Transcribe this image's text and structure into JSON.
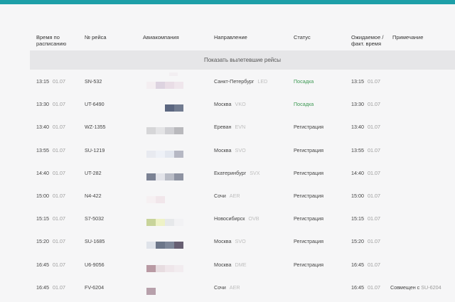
{
  "headers": {
    "scheduled": "Время по расписанию",
    "flight": "№ рейса",
    "airline": "Авиакомпания",
    "direction": "Направление",
    "status": "Статус",
    "expected": "Ожидаемое / факт. время",
    "note": "Примечание"
  },
  "show_departed": "Показать вылетевшие рейсы",
  "colors": {
    "accent": "#1d9fa8",
    "boarding": "#3f9a55"
  },
  "flights": [
    {
      "time": "13:15",
      "date": "01.07",
      "flight": "SN-532",
      "city": "Санкт-Петербург",
      "code": "LED",
      "status": "Посадка",
      "status_type": "board",
      "exp_time": "13:15",
      "exp_date": "01.07",
      "note": "",
      "note_code": "",
      "logo": [
        "#f4eef1",
        "#ddd3e0",
        "#e9dde6",
        "#efe6ec"
      ],
      "logo_top": "#f2eef1"
    },
    {
      "time": "13:30",
      "date": "01.07",
      "flight": "UT-6490",
      "city": "Москва",
      "code": "VKO",
      "status": "Посадка",
      "status_type": "board",
      "exp_time": "13:30",
      "exp_date": "01.07",
      "note": "",
      "note_code": "",
      "logo": [
        "#f6f6f7",
        "#f6f6f7",
        "#5b6680",
        "#717b90"
      ],
      "logo_top": ""
    },
    {
      "time": "13:40",
      "date": "01.07",
      "flight": "WZ-1355",
      "city": "Ереван",
      "code": "EVN",
      "status": "Регистрация",
      "status_type": "reg",
      "exp_time": "13:40",
      "exp_date": "01.07",
      "note": "",
      "note_code": "",
      "logo": [
        "#d6d6d8",
        "#e4e4e6",
        "#cfcfd3",
        "#b9b9bd"
      ],
      "logo_top": ""
    },
    {
      "time": "13:55",
      "date": "01.07",
      "flight": "SU-1219",
      "city": "Москва",
      "code": "SVO",
      "status": "Регистрация",
      "status_type": "reg",
      "exp_time": "13:55",
      "exp_date": "01.07",
      "note": "",
      "note_code": "",
      "logo": [
        "#e8eaf0",
        "#eef1f7",
        "#e3e7ef",
        "#b6b8c4"
      ],
      "logo_top": ""
    },
    {
      "time": "14:40",
      "date": "01.07",
      "flight": "UT-282",
      "city": "Екатеринбург",
      "code": "SVX",
      "status": "Регистрация",
      "status_type": "reg",
      "exp_time": "14:40",
      "exp_date": "01.07",
      "note": "",
      "note_code": "",
      "logo": [
        "#7b8294",
        "#e3e4ea",
        "#b9bcc6",
        "#8e93a2"
      ],
      "logo_top": ""
    },
    {
      "time": "15:00",
      "date": "01.07",
      "flight": "N4-422",
      "city": "Сочи",
      "code": "AER",
      "status": "Регистрация",
      "status_type": "reg",
      "exp_time": "15:00",
      "exp_date": "01.07",
      "note": "",
      "note_code": "",
      "logo": [
        "#f6f0f2",
        "#f1e6ea",
        "#f6f6f7",
        "#f6f6f7"
      ],
      "logo_top": ""
    },
    {
      "time": "15:15",
      "date": "01.07",
      "flight": "S7-5032",
      "city": "Новосибирск",
      "code": "OVB",
      "status": "Регистрация",
      "status_type": "reg",
      "exp_time": "15:15",
      "exp_date": "01.07",
      "note": "",
      "note_code": "",
      "logo": [
        "#c8d49a",
        "#eef2c6",
        "#e6e8ea",
        "#f2f2f4"
      ],
      "logo_top": ""
    },
    {
      "time": "15:20",
      "date": "01.07",
      "flight": "SU-1685",
      "city": "Москва",
      "code": "SVO",
      "status": "Регистрация",
      "status_type": "reg",
      "exp_time": "15:20",
      "exp_date": "01.07",
      "note": "",
      "note_code": "",
      "logo": [
        "#dfe3ea",
        "#6c7689",
        "#7e8799",
        "#675f72"
      ],
      "logo_top": ""
    },
    {
      "time": "16:45",
      "date": "01.07",
      "flight": "U6-9056",
      "city": "Москва",
      "code": "DME",
      "status": "Регистрация",
      "status_type": "reg",
      "exp_time": "16:45",
      "exp_date": "01.07",
      "note": "",
      "note_code": "",
      "logo": [
        "#b99aa4",
        "#e7dce0",
        "#efe6ea",
        "#f2ecef"
      ],
      "logo_top": ""
    },
    {
      "time": "16:45",
      "date": "01.07",
      "flight": "FV-6204",
      "city": "Сочи",
      "code": "AER",
      "status": "",
      "status_type": "reg",
      "exp_time": "16:45",
      "exp_date": "01.07",
      "note": "Совмещен с",
      "note_code": "SU-6204",
      "logo": [
        "#b7a0ab",
        "#f6f6f7",
        "#f6f6f7",
        "#f6f6f7"
      ],
      "logo_top": ""
    }
  ]
}
